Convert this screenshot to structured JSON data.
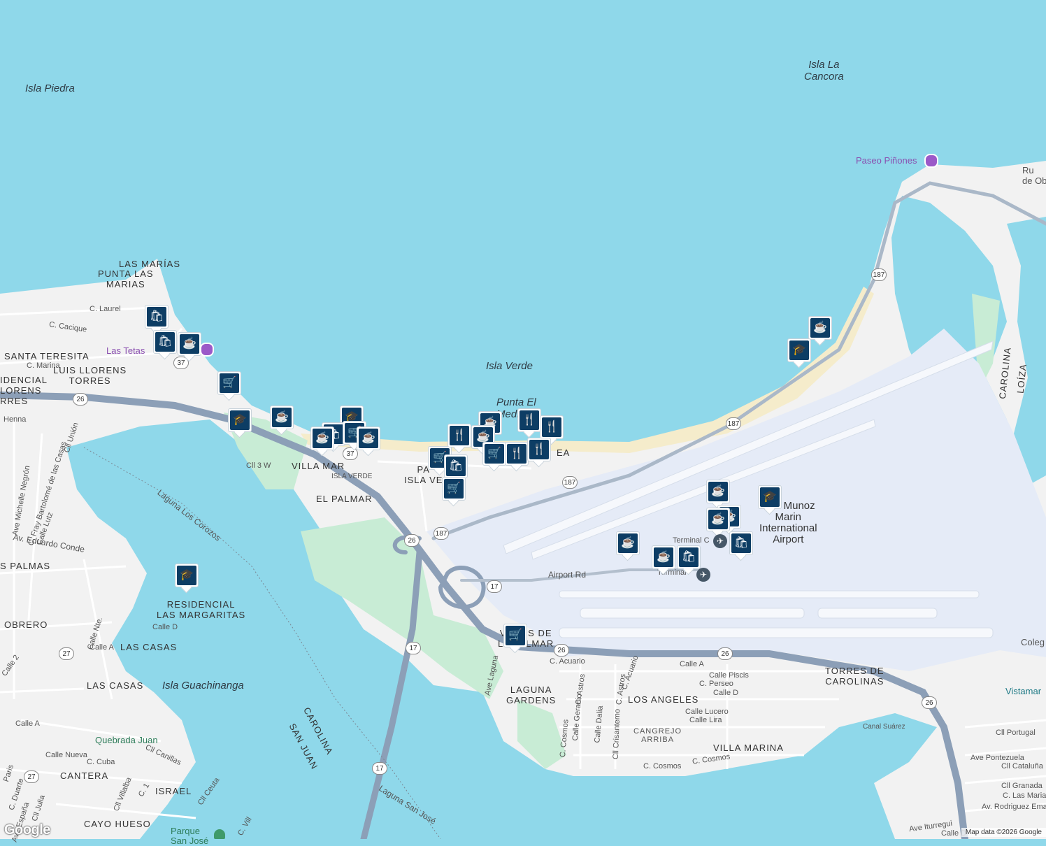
{
  "map": {
    "attribution": "Map data ©2026 Google",
    "logo": "Google",
    "colors": {
      "water": "#8fd8ea",
      "land": "#f2f2f2",
      "airport": "#e5ebf7",
      "park": "#c8ecd5",
      "beach": "#f5eccb",
      "road": "#8c9fb7",
      "pin": "#0d3d64"
    },
    "labels": {
      "isla_piedra": "Isla Piedra",
      "isla_la_cancora": "Isla La\nCancora",
      "isla_verde_water": "Isla Verde",
      "punta_el_medio": "Punta El\nMedio",
      "paseo_pinones": "Paseo Piñones",
      "ruinas": "Ru\nde Ob",
      "las_marias": "LAS MARÍAS",
      "punta_las_marias": "PUNTA LAS\nMARIAS",
      "c_laurel": "C. Laurel",
      "c_cacique": "C. Cacique",
      "las_tetas": "Las Tetas",
      "santa_teresita": "SANTA TERESITA",
      "c_marina": "C. Marina",
      "luis_llorens_torres": "LUIS LLORENS\nTORRES",
      "residencial_llorens": "IDENCIAL\nLORENS\nRRES",
      "henna": "Henna",
      "cll_union": "Cll Unión",
      "c_fray": "C. Fray Bartolomé de las Casas",
      "michelle_negron": "Ave Michelle Negrón",
      "calle_lutz": "Calle Lutz",
      "av_eduardo_conde": "Av. Eduardo Conde",
      "las_palmas": "S PALMAS",
      "obrero": "OBRERO",
      "laguna_los_corozos": "Laguna Los Corozos",
      "villa_mar": "VILLA MAR",
      "cll_3_w": "Cll 3 W",
      "isla_verde_st": "ISLA VERDE",
      "el_palmar": "EL PALMAR",
      "parque_isla_verde": "PA\nISLA VE",
      "ea": "EA",
      "residencial_las_margaritas": "RESIDENCIAL\nLAS MARGARITAS",
      "calle_d": "Calle D",
      "calle_nte": "Calle Nte.",
      "calle_a_west": "Calle A",
      "las_casas_1": "LAS CASAS",
      "las_casas_2": "LAS CASAS",
      "isla_guachinanga": "Isla Guachinanga",
      "calle_2": "Calle 2",
      "calle_a_sw": "Calle A",
      "quebrada_juan": "Quebrada Juan",
      "calle_nueva": "Calle Nueva",
      "c_cuba": "C. Cuba",
      "cll_canillas": "Cll Canillas",
      "cantera": "CANTERA",
      "israel": "ISRAEL",
      "cll_ceuta": "Cll Ceuta",
      "c_1": "C. 1",
      "cll_villalba": "Cll Villalba",
      "cll_julia": "Cll Julia",
      "cayo_hueso": "CAYO HUESO",
      "parque_san_jose": "Parque\nSan José",
      "carolina_west": "CAROLINA",
      "san_juan": "SAN JUAN",
      "laguna_san_jose": "Laguna San José",
      "airport_rd": "Airport Rd",
      "terminal_c": "Terminal C",
      "terminal": "Terminal",
      "airport_name": "Luis Munoz\nMarin\nInternational\nAirport",
      "villas_de_la_palmar": "VILLAS DE\nLA PALMAR",
      "ave_laguna": "Ave Laguna",
      "laguna_gardens": "LAGUNA\nGARDENS",
      "c_acuario": "C. Acuario",
      "c_acuario_2": "C. Acuario",
      "calle_a_east": "Calle A",
      "calle_piscis": "Calle Piscis",
      "c_perseo": "C. Perseo",
      "calle_d_east": "Calle D",
      "c_astros_1": "C. Astros",
      "c_astros_2": "C. Astros",
      "calle_geranio": "Calle Geranio",
      "calle_dalia": "Calle Dalia",
      "cll_crisantemo": "Cll Crisantemo",
      "c_cosmos": "C. Cosmos",
      "los_angeles": "LOS ANGELES",
      "calle_lucero": "Calle Lucero",
      "calle_lira": "Calle Lira",
      "cangrejo_arriba": "CANGREJO\nARRIBA",
      "villa_marina": "VILLA MARINA",
      "c_cosmos_2": "C. Cosmos",
      "c_cosmos_3": "C. Cosmos",
      "torres_de_carolinas": "TORRES DE\nCAROLINAS",
      "canal_suarez": "Canal Suárez",
      "carolina_east": "CAROLINA",
      "loiza": "LOÍZA",
      "colegio": "Coleg",
      "vistamar": "Vistamar",
      "cll_portugal": "Cll Portugal",
      "ave_pontezuela": "Ave Pontezuela",
      "cll_cataluna": "Cll Cataluña",
      "cll_granada": "Cll Granada",
      "c_las_maria": "C. Las Maria",
      "av_rodriguez_ema": "Av. Rodriguez Ema",
      "ave_iturregui": "Ave Iturregui",
      "calle_d_south": "Calle D",
      "ave_espana": "Ave España",
      "c_duarte": "C. Duarte",
      "paris": "Paris",
      "c_vill": "C. Vill"
    },
    "shields": [
      "26",
      "37",
      "37",
      "187",
      "187",
      "187",
      "26",
      "17",
      "17",
      "17",
      "26",
      "26",
      "26",
      "27",
      "27"
    ],
    "pins": {
      "shopping": "shopping-bag-icon",
      "coffee": "coffee-icon",
      "grocery": "shopping-cart-icon",
      "school": "school-icon",
      "restaurant": "restaurant-icon"
    }
  }
}
